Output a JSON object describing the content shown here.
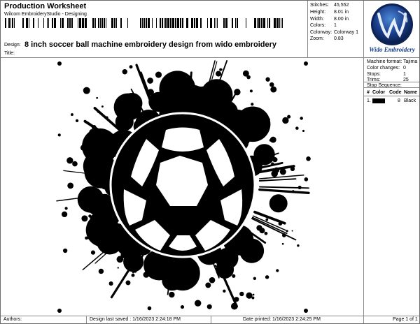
{
  "header": {
    "title": "Production Worksheet",
    "software": "Wilcom EmbroideryStudio - Designing",
    "design_label": "Design:",
    "design_name": "8 inch soccer ball machine embroidery design from wido embroidery",
    "title_label": "Title:"
  },
  "stats": [
    {
      "label": "Stitches:",
      "value": "45,552"
    },
    {
      "label": "Height:",
      "value": "8.01 in"
    },
    {
      "label": "Width:",
      "value": "8.00 in"
    },
    {
      "label": "Colors:",
      "value": "1"
    },
    {
      "label": "Colorway:",
      "value": "Colorway 1"
    },
    {
      "label": "Zoom:",
      "value": "0.83"
    }
  ],
  "logo": {
    "brand": "Wido Embroidery",
    "monogram": "W"
  },
  "machine": [
    {
      "label": "Machine format:",
      "value": "Tajima"
    },
    {
      "label": "Color changes:",
      "value": "0"
    },
    {
      "label": "Stops:",
      "value": "1"
    },
    {
      "label": "Trims:",
      "value": "25"
    }
  ],
  "stop_sequence": {
    "title": "Stop Sequence:",
    "headers": {
      "num": "#",
      "color": "Color",
      "code": "Code",
      "name": "Name"
    },
    "rows": [
      {
        "num": "1.",
        "code": "8",
        "name": "Black",
        "swatch": "#000000"
      }
    ]
  },
  "footer": {
    "authors": "Authors:",
    "saved": "Design last saved : 1/16/2023 2:24:18 PM",
    "printed": "Date printed: 1/16/2023 2:24:25 PM",
    "page": "Page 1 of 1"
  },
  "colors": {
    "accent": "#1a3e8c",
    "lines": "#8a8a8a"
  }
}
